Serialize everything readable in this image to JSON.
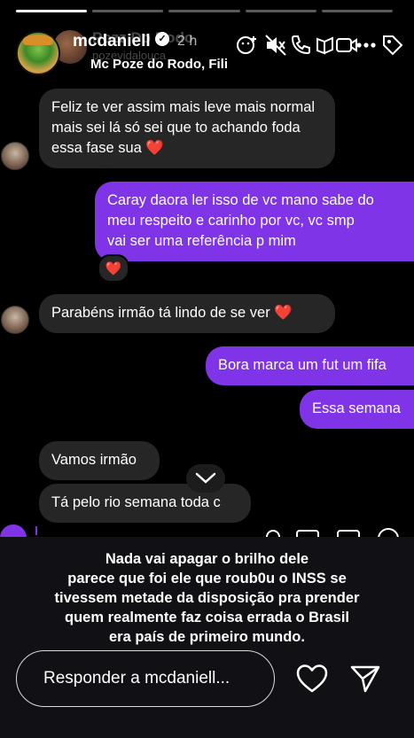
{
  "story": {
    "segments": 5,
    "active_segment": 1
  },
  "header": {
    "username": "mcdaniell",
    "ghost_name": "Pozz Do Rodo",
    "ghost_handle": "pozevidalouca",
    "time_ago": "2 h",
    "music": "Mc Poze do Rodo, Fili",
    "icons": [
      "effects-icon",
      "mute-icon",
      "call-icon",
      "video-icon",
      "more-icon",
      "tag-icon"
    ]
  },
  "messages": [
    {
      "side": "in",
      "lines": [
        "Feliz te ver assim mais leve mais normal",
        "mais sei lá só sei que to achando foda",
        "essa fase sua ❤️"
      ]
    },
    {
      "side": "out",
      "lines": [
        "Caray daora ler isso de vc mano sabe do",
        "meu respeito e carinho por vc, vc smp",
        "vai ser uma referência p mim"
      ],
      "reaction": "❤️"
    },
    {
      "side": "in",
      "lines": [
        "Parabéns irmão tá lindo de se ver ❤️"
      ]
    },
    {
      "side": "out",
      "lines": [
        "Bora marca um fut um fifa"
      ]
    },
    {
      "side": "out",
      "lines": [
        "Essa semana"
      ]
    },
    {
      "side": "in",
      "lines": [
        "Vamos irmão"
      ]
    },
    {
      "side": "in",
      "lines": [
        "Tá pelo rio semana toda c"
      ]
    }
  ],
  "caption": {
    "lines": [
      "Nada vai apagar o brilho dele",
      "parece que foi ele que roub0u o INSS se",
      "tivessem metade da disposição pra prender",
      "quem realmente faz coisa errada o Brasil",
      "era país de primeiro mundo."
    ]
  },
  "reply": {
    "placeholder": "Responder a mcdaniell..."
  },
  "colors": {
    "outgoing": "#7f34e8",
    "incoming": "#262626",
    "background": "#000000",
    "heart": "#ff2d55"
  }
}
